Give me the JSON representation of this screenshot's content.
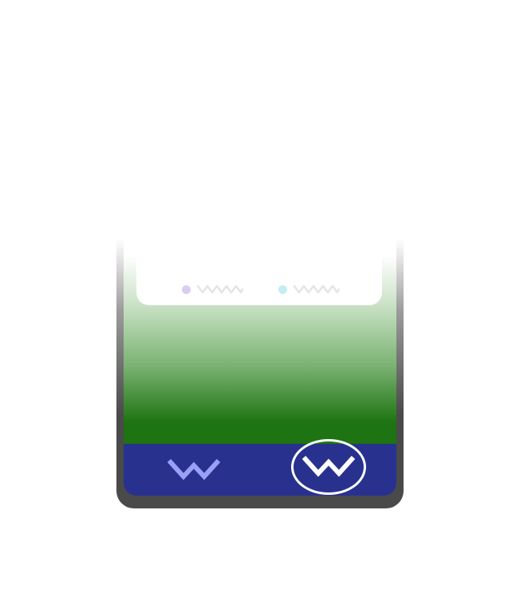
{
  "colors": {
    "frame": "#4a4a4a",
    "screen_gradient_top": "#ffffff",
    "screen_gradient_bottom": "#1e7312",
    "tab_bar": "#29318f",
    "tab_icon_inactive": "#9aa0f7",
    "tab_icon_active": "#ffffff",
    "legend_a_dot": "#d9cdf0",
    "legend_b_dot": "#c3edf2",
    "legend_squiggle": "#e4e4e4"
  },
  "card": {
    "legend": [
      {
        "icon": "dot-icon",
        "label_icon": "squiggle-placeholder-icon"
      },
      {
        "icon": "dot-icon",
        "label_icon": "squiggle-placeholder-icon"
      }
    ]
  },
  "tab_bar": {
    "tabs": [
      {
        "icon": "zigzag-icon",
        "active": false
      },
      {
        "icon": "zigzag-icon",
        "active": true
      }
    ]
  }
}
